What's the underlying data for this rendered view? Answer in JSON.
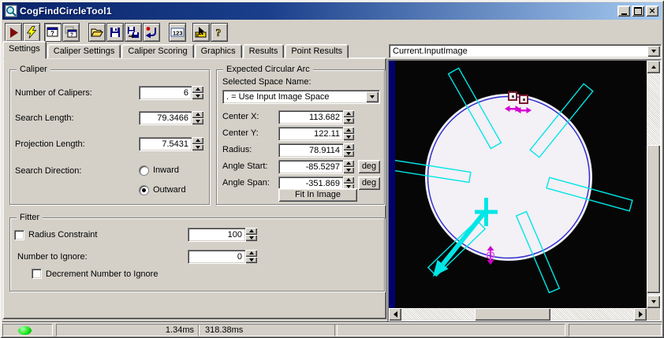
{
  "window": {
    "title": "CogFindCircleTool1"
  },
  "toolbar": {
    "icons": [
      "run-icon",
      "trigger-icon",
      "show-image-window-icon",
      "float-window-icon",
      "open-file-icon",
      "save-icon",
      "save-as-icon",
      "reset-icon",
      "numeric-123-icon",
      "graphics-pick-icon",
      "help-icon"
    ],
    "numeric_icon_text": "123"
  },
  "tabs": {
    "labels": [
      "Settings",
      "Caliper Settings",
      "Caliper Scoring",
      "Graphics",
      "Results",
      "Point Results"
    ],
    "active": "Settings"
  },
  "caliper": {
    "title": "Caliper",
    "num_label": "Number of Calipers:",
    "num_value": "6",
    "search_label": "Search Length:",
    "search_value": "79.3466",
    "proj_label": "Projection Length:",
    "proj_value": "7.5431",
    "dir_label": "Search Direction:",
    "dir_options": [
      "Inward",
      "Outward"
    ],
    "dir_selected": "Outward",
    "inward_label": "Inward",
    "outward_label": "Outward"
  },
  "arc": {
    "title": "Expected Circular Arc",
    "space_label": "Selected Space Name:",
    "space_value": ". = Use Input Image Space",
    "cx_label": "Center X:",
    "cx_value": "113.682",
    "cy_label": "Center Y:",
    "cy_value": "122.11",
    "r_label": "Radius:",
    "r_value": "78.9114",
    "as_label": "Angle Start:",
    "as_value": "-85.5297",
    "asp_label": "Angle Span:",
    "asp_value": "-351.869",
    "deg": "deg",
    "fit_button": "Fit In Image"
  },
  "fitter": {
    "title": "Fitter",
    "rc_label": "Radius Constraint",
    "rc_checked": false,
    "rc_value": "100",
    "ni_label": "Number to Ignore:",
    "ni_value": "0",
    "dec_label": "Decrement Number to Ignore",
    "dec_checked": false
  },
  "image_panel": {
    "selected_image": "Current.InputImage",
    "overlay_colors": {
      "caliper": "#00e6e6",
      "circle": "#2929cc",
      "marker": "#cc00cc",
      "corner_square": "#7d1a2e"
    }
  },
  "status": {
    "time1": "1.34ms",
    "time2": "318.38ms"
  }
}
